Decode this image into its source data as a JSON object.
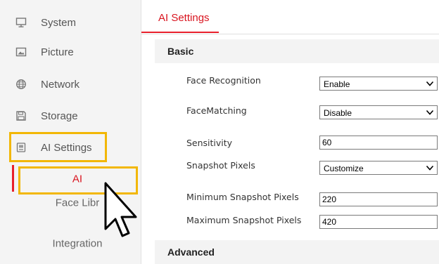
{
  "sidebar": {
    "items": [
      {
        "label": "System",
        "icon": "monitor-icon"
      },
      {
        "label": "Picture",
        "icon": "picture-icon"
      },
      {
        "label": "Network",
        "icon": "globe-icon"
      },
      {
        "label": "Storage",
        "icon": "save-icon"
      },
      {
        "label": "AI Settings",
        "icon": "ai-chip-icon"
      }
    ],
    "subitems": [
      {
        "label": "AI"
      },
      {
        "label": "Face Libr"
      },
      {
        "label": "Integration"
      }
    ]
  },
  "tab": {
    "label": "AI Settings"
  },
  "sections": {
    "basic": "Basic",
    "advanced": "Advanced"
  },
  "fields": {
    "face_recognition": {
      "label": "Face Recognition",
      "value": "Enable"
    },
    "face_matching": {
      "label": "FaceMatching",
      "value": "Disable"
    },
    "sensitivity": {
      "label": "Sensitivity",
      "value": "60"
    },
    "snapshot_pixels": {
      "label": "Snapshot Pixels",
      "value": "Customize"
    },
    "min_snapshot": {
      "label": "Minimum Snapshot Pixels",
      "value": "220"
    },
    "max_snapshot": {
      "label": "Maximum Snapshot Pixels",
      "value": "420"
    }
  },
  "colors": {
    "accent": "#e8202c",
    "highlight": "#f2b705",
    "sidebar_bg": "#f4f4f4"
  }
}
